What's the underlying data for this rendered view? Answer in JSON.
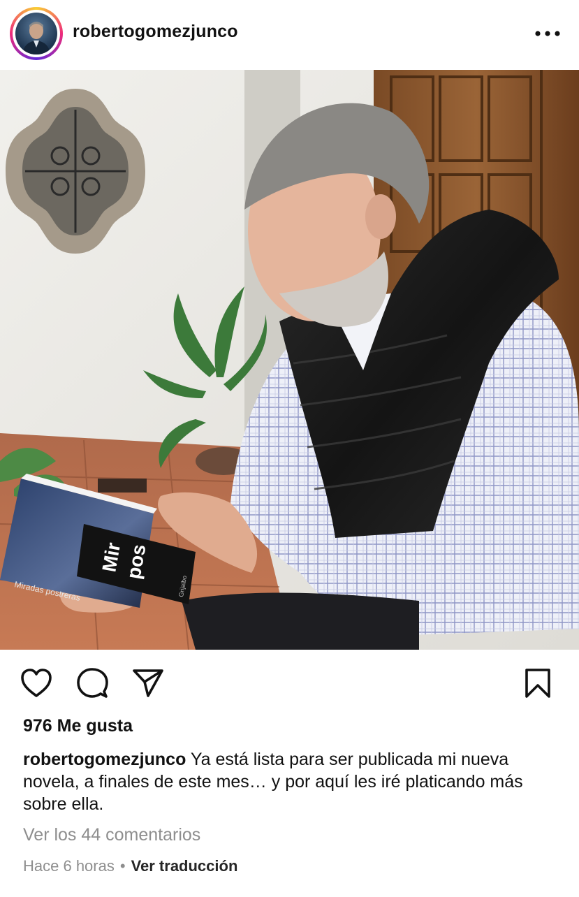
{
  "post": {
    "username": "robertogomezjunco",
    "likes_text": "976 Me gusta",
    "caption_user": "robertogomezjunco",
    "caption_text": "Ya está lista para ser publicada mi nueva novela, a finales de este mes… y por aquí les iré platicando más sobre ella.",
    "comments_link": "Ver los 44 comentarios",
    "time_ago": "Hace 6 horas",
    "separator": "•",
    "translate_link": "Ver traducción"
  },
  "photo": {
    "book_title": "Mir pos",
    "book_title_line1": "Mir",
    "book_title_line2": "pos",
    "book_spine": "Miradas postreras",
    "book_imprint": "Grijalbo"
  },
  "icons": {
    "more": "more-options-icon",
    "like": "heart-icon",
    "comment": "comment-icon",
    "share": "paper-plane-icon",
    "save": "bookmark-icon"
  },
  "colors": {
    "text": "#111111",
    "muted": "#8e8e8e",
    "ring_yellow": "#f9ce34",
    "ring_pink": "#ee2a7b",
    "ring_purple": "#6228d7"
  }
}
